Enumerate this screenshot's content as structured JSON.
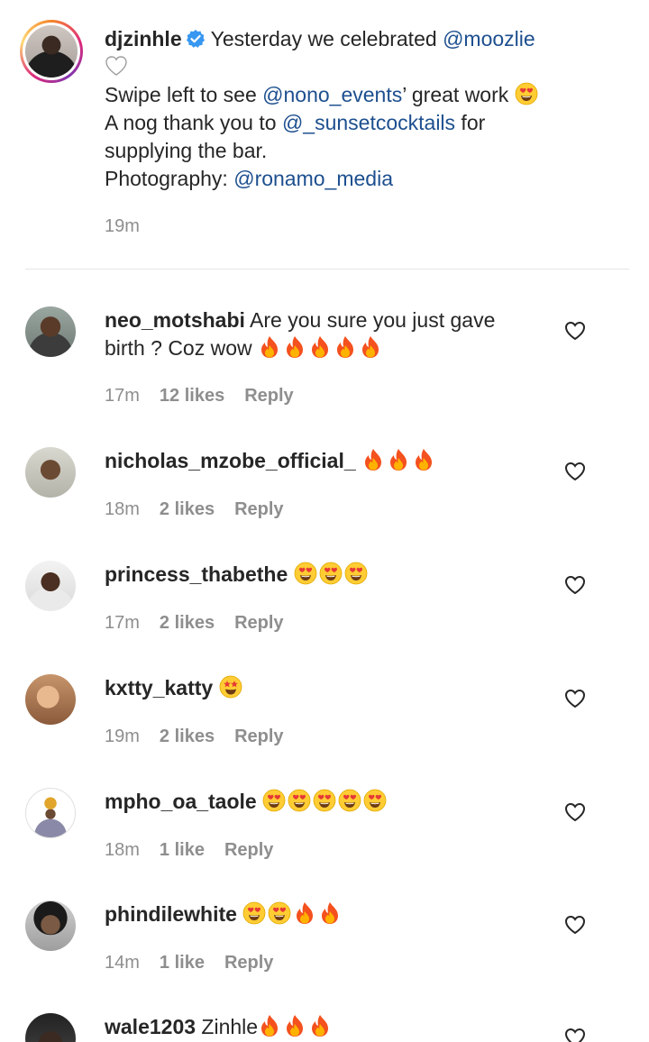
{
  "post": {
    "username": "djzinhle",
    "line1_text": "Yesterday we celebrated ",
    "line1_mention": "@moozlie",
    "line2_pre": "Swipe left to see ",
    "line2_mention": "@nono_events",
    "line2_post": "’ great work ",
    "line3_pre": "A nog thank you to ",
    "line3_mention": "@_sunsetcocktails",
    "line3_post": " for",
    "line4": "supplying the bar.",
    "line5_pre": "Photography: ",
    "line5_mention": "@ronamo_media",
    "time": "19m"
  },
  "comments": [
    {
      "username": "neo_motshabi",
      "text_a": "Are you sure you just gave",
      "text_b": "birth ? Coz wow",
      "time": "17m",
      "likes": "12 likes",
      "reply": "Reply"
    },
    {
      "username": "nicholas_mzobe_official_",
      "time": "18m",
      "likes": "2 likes",
      "reply": "Reply"
    },
    {
      "username": "princess_thabethe",
      "time": "17m",
      "likes": "2 likes",
      "reply": "Reply"
    },
    {
      "username": "kxtty_katty",
      "time": "19m",
      "likes": "2 likes",
      "reply": "Reply"
    },
    {
      "username": "mpho_oa_taole",
      "time": "18m",
      "likes": "1 like",
      "reply": "Reply"
    },
    {
      "username": "phindilewhite",
      "time": "14m",
      "likes": "1 like",
      "reply": "Reply"
    },
    {
      "username": "wale1203",
      "text_a": "Zinhle"
    }
  ],
  "icons": {
    "verified": "verified-badge-icon",
    "heart": "heart-outline-icon",
    "white_heart": "white-heart-emoji",
    "fire": "fire-emoji",
    "heart_eyes": "heart-eyes-emoji",
    "star_struck": "star-struck-emoji"
  },
  "colors": {
    "mention": "#1d4f8f",
    "muted": "#8e8e8e",
    "verified": "#3897f0"
  }
}
